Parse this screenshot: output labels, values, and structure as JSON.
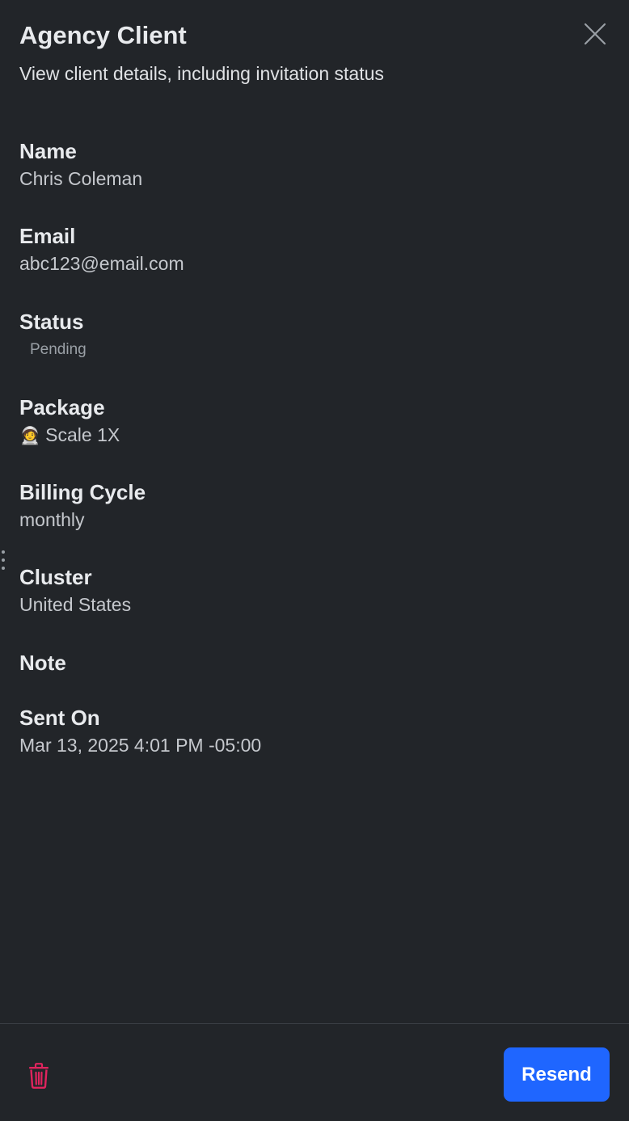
{
  "header": {
    "title": "Agency Client",
    "subtitle": "View client details, including invitation status"
  },
  "fields": {
    "name": {
      "label": "Name",
      "value": "Chris Coleman"
    },
    "email": {
      "label": "Email",
      "value": "abc123@email.com"
    },
    "status": {
      "label": "Status",
      "value": "Pending"
    },
    "package": {
      "label": "Package",
      "icon": "🧑‍🚀",
      "value": "Scale 1X"
    },
    "billing_cycle": {
      "label": "Billing Cycle",
      "value": "monthly"
    },
    "cluster": {
      "label": "Cluster",
      "value": "United States"
    },
    "note": {
      "label": "Note",
      "value": ""
    },
    "sent_on": {
      "label": "Sent On",
      "value": "Mar 13, 2025 4:01 PM -05:00"
    }
  },
  "footer": {
    "resend_label": "Resend",
    "delete_icon": "trash-icon"
  },
  "colors": {
    "background": "#222529",
    "accent": "#1f66ff",
    "danger": "#e0245e"
  }
}
